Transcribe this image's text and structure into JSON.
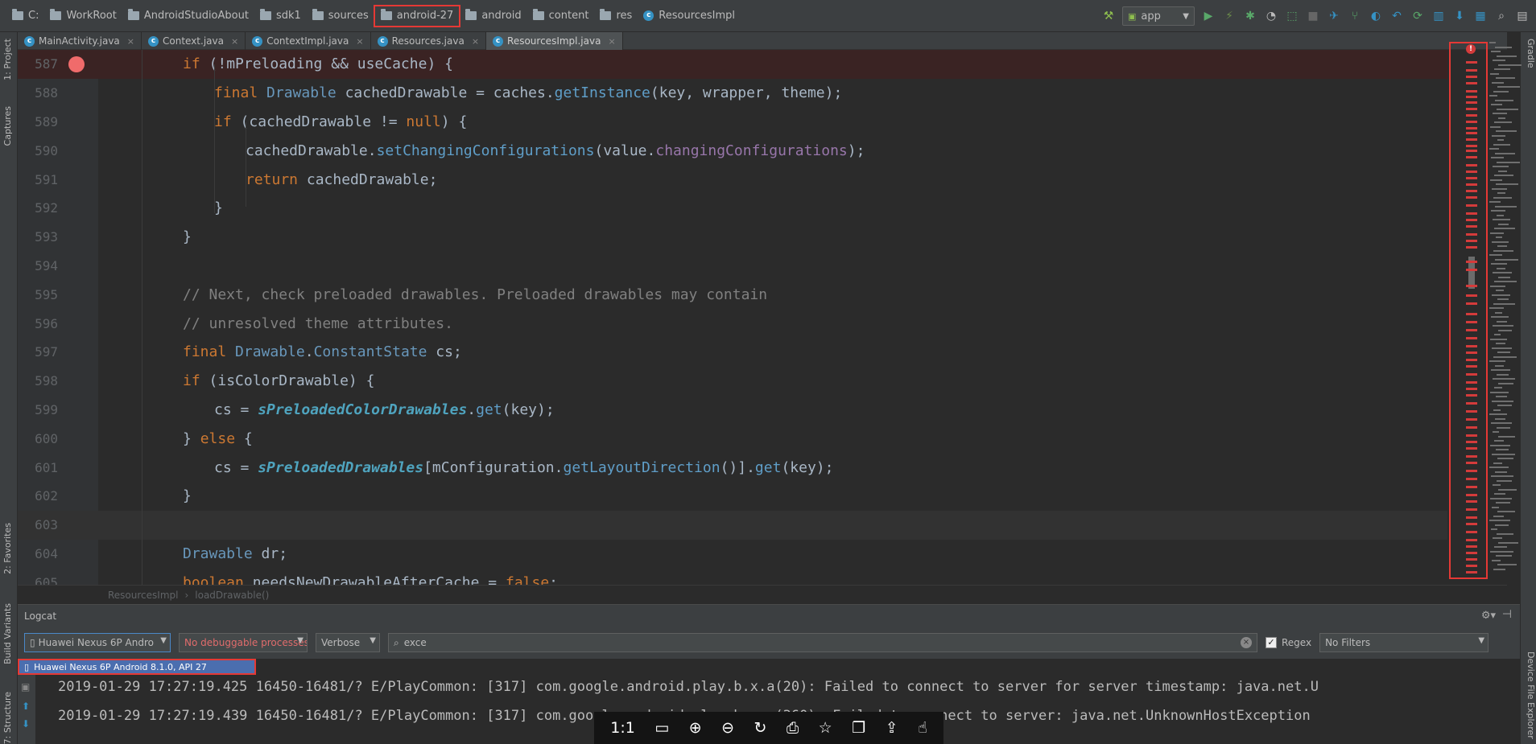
{
  "breadcrumbs": [
    "C:",
    "WorkRoot",
    "AndroidStudioAbout",
    "sdk1",
    "sources",
    "android-27",
    "android",
    "content",
    "res",
    "ResourcesImpl"
  ],
  "run_config": "app",
  "tabs": [
    "MainActivity.java",
    "Context.java",
    "ContextImpl.java",
    "Resources.java",
    "ResourcesImpl.java"
  ],
  "left_tools": [
    "1: Project",
    "Captures",
    "2: Favorites",
    "Build Variants",
    "7: Structure"
  ],
  "right_tools": [
    "Gradle",
    "Device File Explorer"
  ],
  "editor": {
    "lines": [
      {
        "n": "587",
        "segs": [
          [
            "kw",
            "if "
          ],
          [
            "plain",
            "(!mPreloading && useCache) {"
          ]
        ]
      },
      {
        "n": "588",
        "segs": [
          [
            "kw",
            "final "
          ],
          [
            "cls",
            "Drawable "
          ],
          [
            "plain",
            "cachedDrawable = caches."
          ],
          [
            "mth",
            "getInstance"
          ],
          [
            "plain",
            "(key, wrapper, theme);"
          ]
        ]
      },
      {
        "n": "589",
        "segs": [
          [
            "kw",
            "if "
          ],
          [
            "plain",
            "(cachedDrawable != "
          ],
          [
            "kw",
            "null"
          ],
          [
            "plain",
            ") {"
          ]
        ]
      },
      {
        "n": "590",
        "segs": [
          [
            "plain",
            "cachedDrawable."
          ],
          [
            "mth",
            "setChangingConfigurations"
          ],
          [
            "plain",
            "(value."
          ],
          [
            "fld",
            "changingConfigurations"
          ],
          [
            "plain",
            ");"
          ]
        ]
      },
      {
        "n": "591",
        "segs": [
          [
            "kw",
            "return "
          ],
          [
            "plain",
            "cachedDrawable;"
          ]
        ]
      },
      {
        "n": "592",
        "segs": [
          [
            "plain",
            "}"
          ]
        ]
      },
      {
        "n": "593",
        "segs": [
          [
            "plain",
            "}"
          ]
        ]
      },
      {
        "n": "594",
        "segs": []
      },
      {
        "n": "595",
        "segs": [
          [
            "cmt",
            "// Next, check preloaded drawables. Preloaded drawables may contain"
          ]
        ]
      },
      {
        "n": "596",
        "segs": [
          [
            "cmt",
            "// unresolved theme attributes."
          ]
        ]
      },
      {
        "n": "597",
        "segs": [
          [
            "kw",
            "final "
          ],
          [
            "cls",
            "Drawable"
          ],
          [
            "plain",
            "."
          ],
          [
            "cls",
            "ConstantState "
          ],
          [
            "plain",
            "cs;"
          ]
        ]
      },
      {
        "n": "598",
        "segs": [
          [
            "kw",
            "if "
          ],
          [
            "plain",
            "(isColorDrawable) {"
          ]
        ]
      },
      {
        "n": "599",
        "segs": [
          [
            "plain",
            "cs = "
          ],
          [
            "sfld",
            "sPreloadedColorDrawables"
          ],
          [
            "plain",
            "."
          ],
          [
            "mth",
            "get"
          ],
          [
            "plain",
            "(key);"
          ]
        ]
      },
      {
        "n": "600",
        "segs": [
          [
            "plain",
            "} "
          ],
          [
            "kw",
            "else "
          ],
          [
            "plain",
            "{"
          ]
        ]
      },
      {
        "n": "601",
        "segs": [
          [
            "plain",
            "cs = "
          ],
          [
            "sfld",
            "sPreloadedDrawables"
          ],
          [
            "plain",
            "[mConfiguration."
          ],
          [
            "mth",
            "getLayoutDirection"
          ],
          [
            "plain",
            "()]."
          ],
          [
            "mth",
            "get"
          ],
          [
            "plain",
            "(key);"
          ]
        ]
      },
      {
        "n": "602",
        "segs": [
          [
            "plain",
            "}"
          ]
        ]
      },
      {
        "n": "603",
        "segs": []
      },
      {
        "n": "604",
        "segs": [
          [
            "cls",
            "Drawable "
          ],
          [
            "plain",
            "dr;"
          ]
        ]
      },
      {
        "n": "605",
        "segs": [
          [
            "kw",
            "boolean "
          ],
          [
            "plain",
            "needsNewDrawableAfterCache = "
          ],
          [
            "kw",
            "false"
          ],
          [
            "plain",
            ";"
          ]
        ]
      }
    ]
  },
  "editor_breadcrumb": [
    "ResourcesImpl",
    "loadDrawable()"
  ],
  "logcat": {
    "title": "Logcat",
    "device_select": "Huawei Nexus 6P Andro",
    "process_select": "No debuggable processes",
    "level_select": "Verbose",
    "search_value": "exce",
    "regex_label": "Regex",
    "regex_checked": true,
    "filter_select": "No Filters",
    "device_popup": "Huawei Nexus 6P Android 8.1.0, API 27",
    "lines": [
      "2019-01-29 17:27:19.425 16450-16481/? E/PlayCommon: [317] com.google.android.play.b.x.a(20): Failed to connect to server for server timestamp: java.net.U",
      "2019-01-29 17:27:19.439 16450-16481/? E/PlayCommon: [317] com.google.android.play.b.g.a(360): Failed to connect to server: java.net.UnknownHostException"
    ]
  },
  "viewer_toolbar": {
    "ratio": "1:1"
  },
  "colors": {
    "accent_red": "#e53935",
    "background": "#2b2b2b",
    "panel": "#3c3f41"
  }
}
